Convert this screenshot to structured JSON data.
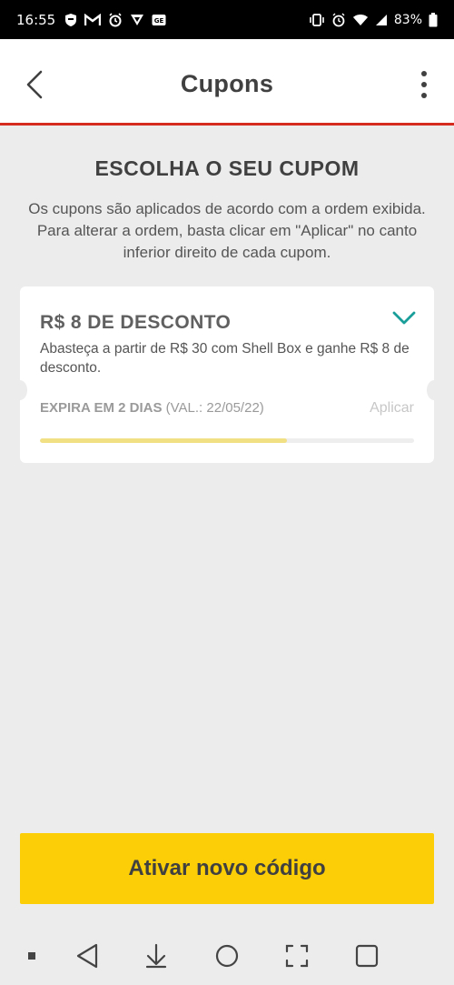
{
  "status_bar": {
    "time": "16:55",
    "battery": "83%",
    "left_icons": [
      "shield-icon",
      "gmail-icon",
      "alarm-sync-icon",
      "vpn-icon",
      "news-icon"
    ],
    "right_icons": [
      "vibrate-icon",
      "alarm-icon",
      "wifi-icon",
      "signal-icon",
      "battery-icon"
    ]
  },
  "appbar": {
    "title": "Cupons",
    "accent_color": "#d52b1e"
  },
  "content": {
    "heading": "ESCOLHA O SEU CUPOM",
    "subtext": "Os cupons são aplicados de acordo com a ordem exibida. Para alterar a ordem, basta clicar em \"Aplicar\" no canto inferior direito de cada cupom."
  },
  "coupon": {
    "title": "R$ 8 DE DESCONTO",
    "description": "Abasteça a partir de R$ 30 com Shell Box e ganhe R$ 8 de desconto.",
    "expira_label": "EXPIRA EM 2 DIAS",
    "validade": "(VAL.: 22/05/22)",
    "apply_label": "Aplicar",
    "progress_fraction": 0.66,
    "chevron_color": "#1a9e9a",
    "progress_color": "#f2e085"
  },
  "cta": {
    "label": "Ativar novo código",
    "color": "#fbce07"
  },
  "navbar": {
    "buttons": [
      "dot-icon",
      "back-triangle-icon",
      "download-icon",
      "home-circle-icon",
      "screenshot-icon",
      "recents-square-icon"
    ]
  }
}
